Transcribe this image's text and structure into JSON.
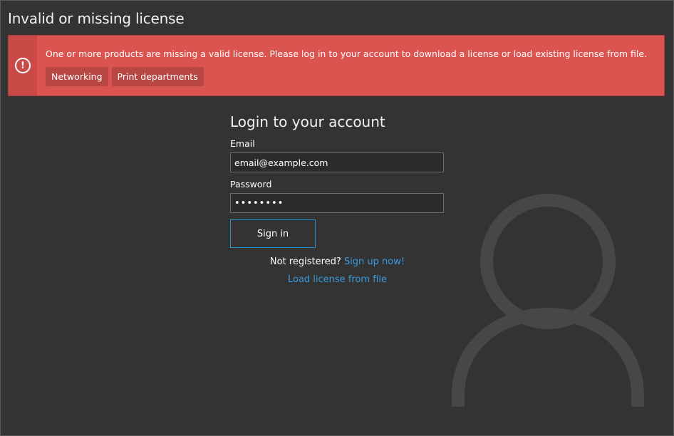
{
  "page": {
    "title": "Invalid or missing license"
  },
  "alert": {
    "icon": "exclamation-circle-icon",
    "message": "One or more products are missing a valid license. Please log in to your account to download a license or load existing license from file.",
    "tags": [
      {
        "label": "Networking"
      },
      {
        "label": "Print departments"
      }
    ],
    "colors": {
      "background": "#db5450",
      "strip": "#c94a47",
      "tag": "#b84744"
    }
  },
  "login": {
    "heading": "Login to your account",
    "email_label": "Email",
    "email_value": "email@example.com",
    "password_label": "Password",
    "password_value": "••••••••",
    "signin_label": "Sign in",
    "not_registered_text": "Not registered?",
    "signup_link": "Sign up now!",
    "load_license_link": "Load license from file"
  },
  "theme": {
    "background": "#333333",
    "accent": "#2b8fd6",
    "link": "#3a9bdc",
    "avatar_watermark": "user-silhouette-icon"
  }
}
